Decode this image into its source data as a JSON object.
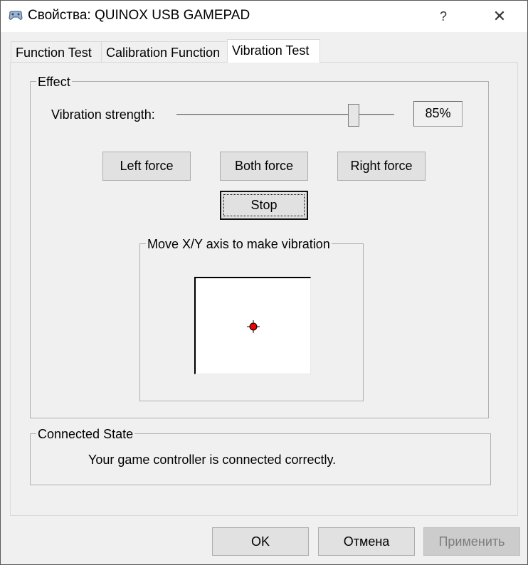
{
  "window": {
    "title": "Свойства: QUINOX USB GAMEPAD",
    "help_glyph": "?",
    "close_glyph": "✕",
    "icon": "gamepad-icon"
  },
  "tabs": [
    {
      "label": "Function Test",
      "active": false
    },
    {
      "label": "Calibration Function",
      "active": false
    },
    {
      "label": "Vibration Test",
      "active": true
    }
  ],
  "effect": {
    "group_label": "Effect",
    "strength_label": "Vibration strength:",
    "strength_value": "85%",
    "strength_fraction": 0.85,
    "buttons": {
      "left": "Left force",
      "both": "Both force",
      "right": "Right force",
      "stop": "Stop"
    },
    "xy_group_label": "Move X/Y axis to make vibration",
    "crosshair_color": "#ff0000"
  },
  "connected": {
    "group_label": "Connected State",
    "message": "Your game controller is connected correctly."
  },
  "footer": {
    "ok": "OK",
    "cancel": "Отмена",
    "apply": "Применить",
    "apply_enabled": false
  }
}
